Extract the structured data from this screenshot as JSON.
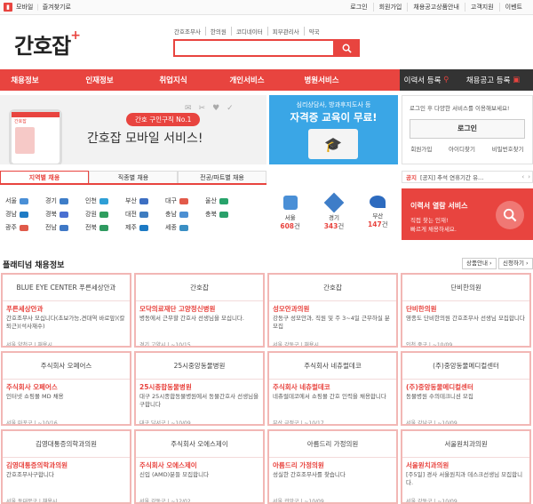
{
  "topbar": {
    "mobile_label": "모바일",
    "favorite_label": "즐겨찾기로",
    "links": [
      "로그인",
      "회원가입",
      "채용공고상품안내",
      "고객지원",
      "이벤트"
    ]
  },
  "logo": {
    "text": "간호잡",
    "plus": "+"
  },
  "search": {
    "links": [
      "간호조무사",
      "한의원",
      "코디네이터",
      "피부관리사",
      "약국"
    ],
    "value": ""
  },
  "nav": {
    "items": [
      "채용정보",
      "인재정보",
      "취업지식",
      "개인서비스",
      "병원서비스"
    ],
    "resume_btn": "이력서 등록",
    "job_btn": "채용공고 등록"
  },
  "banner": {
    "badge": "간호 구인구직 No.1",
    "title": "간호잡 모바일 서비스!",
    "phone_brand": "간호잡"
  },
  "banner2": {
    "line1": "심리상담사, 방과후지도사 등",
    "line2": "자격증 교육이 무료!"
  },
  "login": {
    "desc": "로그인 후 다양한 서비스를 이용해보세요!",
    "button": "로그인",
    "links": [
      "회원가입",
      "아이디찾기",
      "비밀번호찾기"
    ]
  },
  "notice": {
    "tag": "공지",
    "text": "[공지] 추석 연휴기간 유..."
  },
  "region_tabs": {
    "items": [
      "지역별 채용",
      "직종별 채용",
      "전공/파트별 채용"
    ]
  },
  "regions": {
    "items": [
      "서울",
      "경기",
      "인천",
      "부산",
      "대구",
      "울산",
      "경남",
      "경북",
      "강원",
      "대전",
      "충남",
      "충북",
      "광주",
      "전남",
      "전북",
      "제주",
      "세종"
    ]
  },
  "counts": {
    "items": [
      {
        "city": "서울",
        "count": "608",
        "unit": "건"
      },
      {
        "city": "경기",
        "count": "343",
        "unit": "건"
      },
      {
        "city": "부산",
        "count": "147",
        "unit": "건"
      }
    ]
  },
  "openbox": {
    "title": "이력서 열람 서비스",
    "line1": "직접 찾는 인재!",
    "line2": "빠르게 채용하세요."
  },
  "platinum": {
    "title": "플래티넘 채용정보",
    "btn_info": "상품안내",
    "btn_apply": "신청하기"
  },
  "cards": [
    {
      "logo": "BLUE EYE CENTER 푸른세상안과",
      "company": "푸른세상안과",
      "desc": "간호조무사 모십니다(초보가능,견대역 바로앞)(칼퇴근)(석사재수)",
      "meta": "서울 양천구 | 채용시"
    },
    {
      "logo": "간호잡",
      "company": "모닥의료재단 고양정신병원",
      "desc": "병동에서 근무할 간호사 선생님을 모십니다.",
      "meta": "경기 고양시 | ~10/15"
    },
    {
      "logo": "간호잡",
      "company": "성모안과의원",
      "desc": "강동구 성모안과, 직원 및 주 3~4일 근무하실 분 모집",
      "meta": "서울 강동구 | 채용시"
    },
    {
      "logo": "단비한의원",
      "company": "단비한의원",
      "desc": "영종도 단비한의원 간호조무사 선생님 모집합니다",
      "meta": "인천 중구 | ~10/09"
    },
    {
      "logo": "주식회사 오페어스",
      "company": "주식회사 오페어스",
      "desc": "인터넷 쇼핑몰 MD 채용",
      "meta": "서울 마포구 | ~10/16"
    },
    {
      "logo": "25시중앙동물병원",
      "company": "25시종합동물병원",
      "desc": "대구 25시종합동물병원에서 동물간호사 선생님을 구합니다",
      "meta": "대구 달서구 | ~10/09"
    },
    {
      "logo": "주식회사 네츄럴데코",
      "company": "주식회사 네츄럴데코",
      "desc": "네츄럴데코에서 쇼핑몰 간호 인력을 채용합니다",
      "meta": "부산 금정구 | ~10/17"
    },
    {
      "logo": "(주)중앙동물메디컬센터",
      "company": "(주)중앙동물메디컬센터",
      "desc": "동물병원 수의테크니션 모집",
      "meta": "서울 강남구 | ~10/09"
    },
    {
      "logo": "김영대통증의학과의원",
      "company": "김영대통증의학과의원",
      "desc": "간호조무사구합니다",
      "meta": "서울 동대문구 | 채용시"
    },
    {
      "logo": "주식회사 오에스제이",
      "company": "주식회사 오에스제이",
      "desc": "신입 (AMD)분들 모집합니다",
      "meta": "서울 강동구 | ~12/02"
    },
    {
      "logo": "아름드리 가정의원",
      "company": "아름드리 가정의원",
      "desc": "성실한 간호조무사를 찾습니다",
      "meta": "서울 관악구 | ~10/09"
    },
    {
      "logo": "서울원치과의원",
      "company": "서울원치과의원",
      "desc": "[주5일] 경사 서울원치과 데스크선생님 모집합니다.",
      "meta": "서울 강동구 | ~10/09"
    }
  ]
}
